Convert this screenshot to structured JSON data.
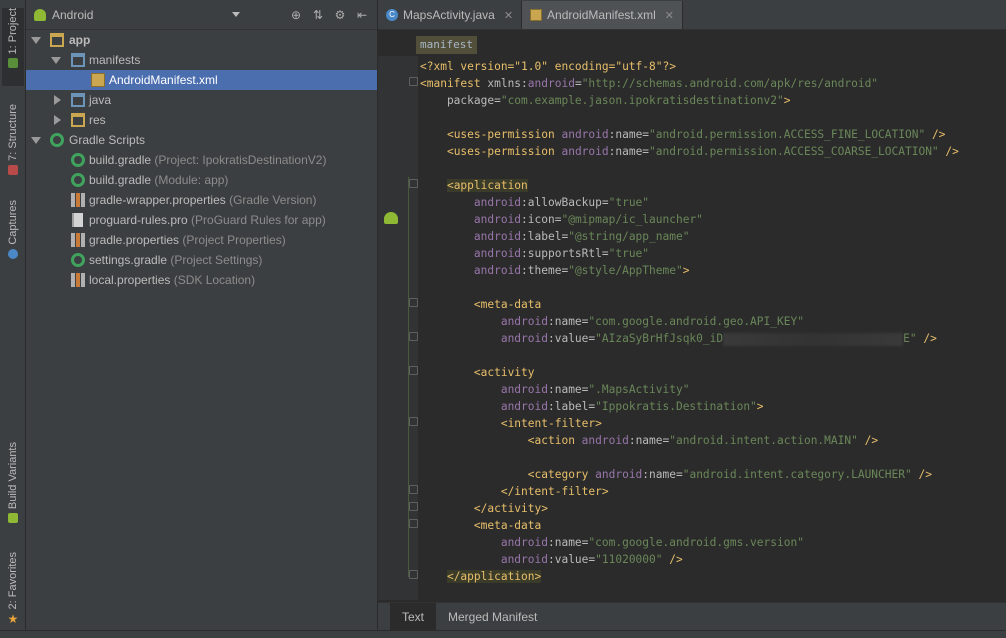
{
  "stripe": {
    "project": "1: Project",
    "structure": "7: Structure",
    "captures": "Captures",
    "build_variants": "Build Variants",
    "favorites": "2: Favorites"
  },
  "project_panel": {
    "view_mode": "Android",
    "tree": [
      {
        "label": "app",
        "hint": ""
      },
      {
        "label": "manifests",
        "hint": ""
      },
      {
        "label": "AndroidManifest.xml",
        "hint": ""
      },
      {
        "label": "java",
        "hint": ""
      },
      {
        "label": "res",
        "hint": ""
      },
      {
        "label": "Gradle Scripts",
        "hint": ""
      },
      {
        "label": "build.gradle",
        "hint": " (Project: IpokratisDestinationV2)"
      },
      {
        "label": "build.gradle",
        "hint": " (Module: app)"
      },
      {
        "label": "gradle-wrapper.properties",
        "hint": " (Gradle Version)"
      },
      {
        "label": "proguard-rules.pro",
        "hint": " (ProGuard Rules for app)"
      },
      {
        "label": "gradle.properties",
        "hint": " (Project Properties)"
      },
      {
        "label": "settings.gradle",
        "hint": " (Project Settings)"
      },
      {
        "label": "local.properties",
        "hint": " (SDK Location)"
      }
    ]
  },
  "editor": {
    "tabs": [
      {
        "label": "MapsActivity.java"
      },
      {
        "label": "AndroidManifest.xml"
      }
    ],
    "breadcrumb": "manifest",
    "bottom_tabs": [
      "Text",
      "Merged Manifest"
    ],
    "code": {
      "l1": "<?xml version=\"1.0\" encoding=\"utf-8\"?>",
      "l2a": "<manifest ",
      "l2b": "xmlns:",
      "l2c": "android",
      "l2d": "=",
      "l2e": "\"http://schemas.android.com/apk/res/android\"",
      "l3a": "    package=",
      "l3b": "\"com.example.jason.ipokratisdestinationv2\"",
      "l3c": ">",
      "perm1_val": "\"android.permission.ACCESS_FINE_LOCATION\"",
      "perm2_val": "\"android.permission.ACCESS_COARSE_LOCATION\"",
      "app_tag": "<application",
      "allowBackup": "\"true\"",
      "icon": "\"@mipmap/ic_launcher\"",
      "label": "\"@string/app_name\"",
      "supportsRtl": "\"true\"",
      "theme": "\"@style/AppTheme\"",
      "meta_name_1": "\"com.google.android.geo.API_KEY\"",
      "meta_value_1": "\"AIzaSyBrHfJsqk0_iD",
      "meta_value_1_end": "E\"",
      "act_name": "\".MapsActivity\"",
      "act_label": "\"Ippokratis.Destination\"",
      "action_name": "\"android.intent.action.MAIN\"",
      "category_name": "\"android.intent.category.LAUNCHER\"",
      "meta_name_2": "\"com.google.android.gms.version\"",
      "meta_value_2": "\"11020000\"",
      "app_close": "</application>"
    }
  },
  "colors": {
    "tag": "#e8bf6a",
    "namespace": "#9876aa",
    "value": "#6a8759",
    "selection": "#4b6eaf"
  }
}
